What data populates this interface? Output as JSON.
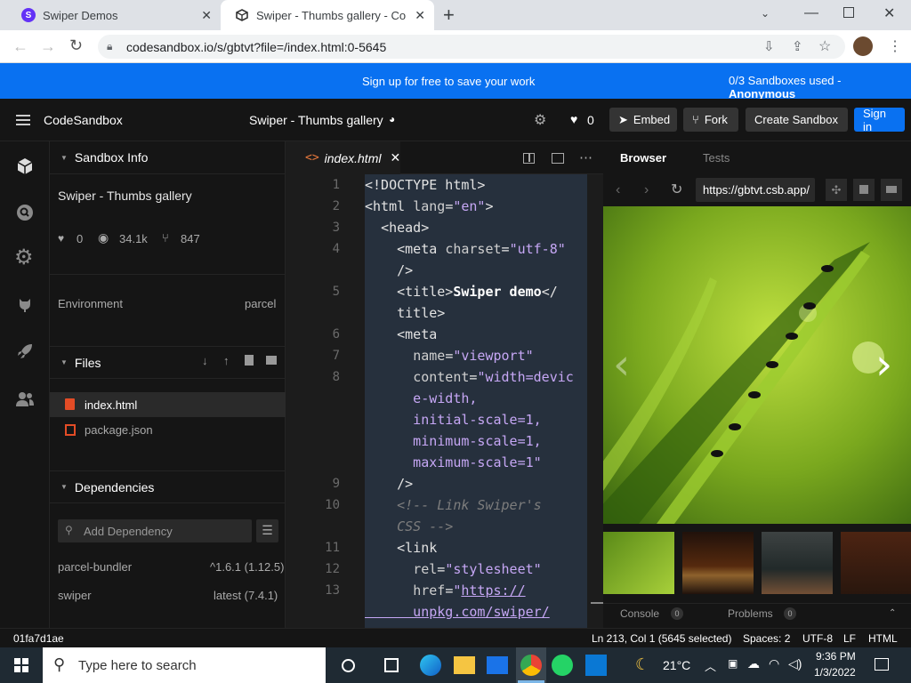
{
  "browser": {
    "tabs": [
      {
        "title": "Swiper Demos",
        "favicon": "S"
      },
      {
        "title": "Swiper - Thumbs gallery - CodeS",
        "favicon": "cube"
      }
    ],
    "new_tab": "+",
    "url": "codesandbox.io/s/gbtvt?file=/index.html:0-5645"
  },
  "banner": {
    "message": "Sign up for free to save your work",
    "usage_prefix": "0/3 Sandboxes used - ",
    "usage_user": "Anonymous"
  },
  "header": {
    "brand": "CodeSandbox",
    "title": "Swiper - Thumbs gallery",
    "likes": "0",
    "embed": "Embed",
    "fork": "Fork",
    "create": "Create Sandbox",
    "signin": "Sign in"
  },
  "sidebar": {
    "info_title": "Sandbox Info",
    "sandbox_name": "Swiper - Thumbs gallery",
    "stats": {
      "likes": "0",
      "views": "34.1k",
      "forks": "847"
    },
    "env_label": "Environment",
    "env_value": "parcel",
    "files_title": "Files",
    "files": [
      {
        "name": "index.html"
      },
      {
        "name": "package.json"
      }
    ],
    "deps_title": "Dependencies",
    "dep_placeholder": "Add Dependency",
    "deps": [
      {
        "name": "parcel-bundler",
        "version": "^1.6.1 (1.12.5)"
      },
      {
        "name": "swiper",
        "version": "latest (7.4.1)"
      }
    ]
  },
  "editor": {
    "tab": "index.html",
    "line_numbers": [
      "1",
      "2",
      "3",
      "4",
      "5",
      "6",
      "7",
      "8",
      "9",
      "10",
      "11",
      "12",
      "13"
    ]
  },
  "preview": {
    "tabs": [
      "Browser",
      "Tests"
    ],
    "url": "https://gbtvt.csb.app/",
    "console_label": "Console",
    "console_count": "0",
    "problems_label": "Problems",
    "problems_count": "0"
  },
  "status": {
    "id": "01fa7d1ae",
    "position": "Ln 213, Col 1 (5645 selected)",
    "spaces": "Spaces: 2",
    "encoding": "UTF-8",
    "eol": "LF",
    "language": "HTML"
  },
  "taskbar": {
    "search_placeholder": "Type here to search",
    "weather": "21°C",
    "time": "9:36 PM",
    "date": "1/3/2022"
  },
  "colors": {
    "accent": "#0971f1",
    "dark": "#151515",
    "selection": "#2b3a4f"
  }
}
